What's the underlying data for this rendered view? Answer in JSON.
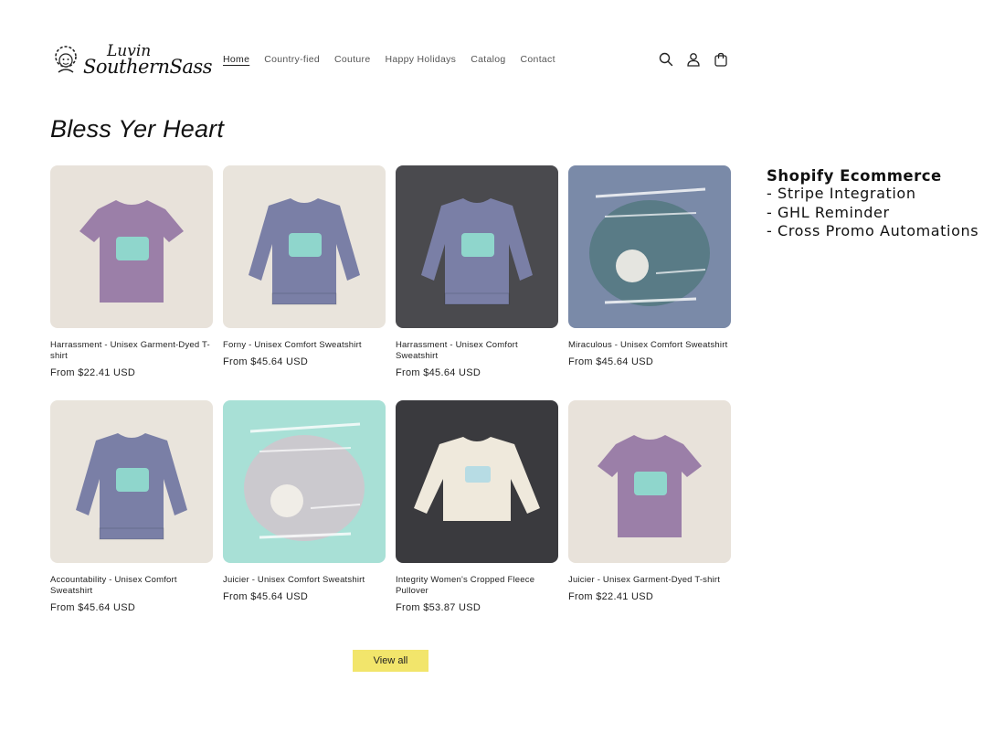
{
  "brand": {
    "line1": "Luvin",
    "line2": "SouthernSass"
  },
  "nav": [
    {
      "label": "Home",
      "active": true
    },
    {
      "label": "Country-fied",
      "active": false
    },
    {
      "label": "Couture",
      "active": false
    },
    {
      "label": "Happy Holidays",
      "active": false
    },
    {
      "label": "Catalog",
      "active": false
    },
    {
      "label": "Contact",
      "active": false
    }
  ],
  "header_icons": [
    "search-icon",
    "account-icon",
    "cart-icon"
  ],
  "collection": {
    "title": "Bless Yer Heart",
    "products": [
      {
        "title": "Harrassment - Unisex Garment-Dyed T-shirt",
        "price": "From $22.41 USD",
        "kind": "tshirt",
        "bg": "#e8e2da",
        "garment": "#9b7fa8"
      },
      {
        "title": "Forny - Unisex Comfort Sweatshirt",
        "price": "From $45.64 USD",
        "kind": "sweatshirt",
        "bg": "#e9e4dc",
        "garment": "#7a7fa6"
      },
      {
        "title": "Harrassment - Unisex Comfort Sweatshirt",
        "price": "From $45.64 USD",
        "kind": "sweatshirt",
        "bg": "#4a4a4e",
        "garment": "#7a7fa6"
      },
      {
        "title": "Miraculous - Unisex Comfort Sweatshirt",
        "price": "From $45.64 USD",
        "kind": "artwork",
        "bg": "#7a8aa8",
        "garment": "#3e6f6a"
      },
      {
        "title": "Accountability - Unisex Comfort Sweatshirt",
        "price": "From $45.64 USD",
        "kind": "sweatshirt",
        "bg": "#e9e4dc",
        "garment": "#7a7fa6"
      },
      {
        "title": "Juicier - Unisex Comfort Sweatshirt",
        "price": "From $45.64 USD",
        "kind": "artwork",
        "bg": "#a8e0d6",
        "garment": "#e8b7c8"
      },
      {
        "title": "Integrity Women's Cropped Fleece Pullover",
        "price": "From $53.87 USD",
        "kind": "pullover",
        "bg": "#3a3a3e",
        "garment": "#efe9dc"
      },
      {
        "title": "Juicier - Unisex Garment-Dyed T-shirt",
        "price": "From $22.41 USD",
        "kind": "tshirt",
        "bg": "#e8e2da",
        "garment": "#9b7fa8"
      }
    ]
  },
  "view_all_label": "View all",
  "overlay": {
    "heading": "Shopify Ecommerce",
    "items": [
      "- Stripe Integration",
      "- GHL Reminder",
      "- Cross Promo Automations"
    ]
  },
  "colors": {
    "button": "#f2e56b",
    "text": "#121212"
  }
}
